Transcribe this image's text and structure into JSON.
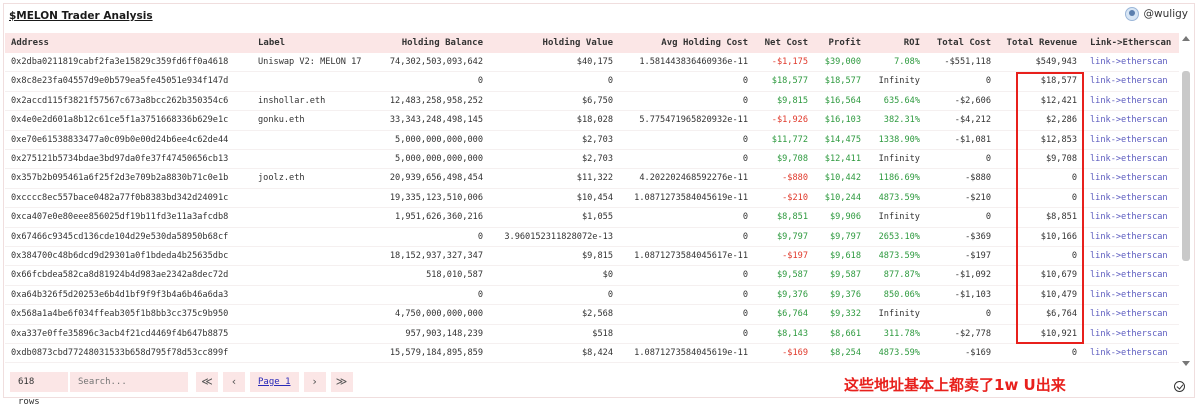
{
  "title": "$MELON Trader Analysis",
  "user": {
    "name": "@wuligy"
  },
  "table": {
    "headers": [
      "Address",
      "Label",
      "Holding Balance",
      "Holding Value",
      "Avg Holding Cost",
      "Net Cost",
      "Profit",
      "ROI",
      "Total Cost",
      "Total Revenue",
      "Link->Etherscan"
    ],
    "rows": [
      [
        "0x2dba0211819cabf2fa3e15829c359fd6ff0a4618",
        "Uniswap V2: MELON 17",
        "74,302,503,093,642",
        "$40,175",
        "1.581443836460936e-11",
        "-$1,175",
        "$39,000",
        "7.08%",
        "-$551,118",
        "$549,943",
        "link->etherscan"
      ],
      [
        "0x8c8e23fa04557d9e0b579ea5fe45051e934f147d",
        "",
        "0",
        "0",
        "0",
        "$18,577",
        "$18,577",
        "Infinity",
        "0",
        "$18,577",
        "link->etherscan"
      ],
      [
        "0x2accd115f3821f57567c673a8bcc262b350354c6",
        "inshollar.eth",
        "12,483,258,958,252",
        "$6,750",
        "0",
        "$9,815",
        "$16,564",
        "635.64%",
        "-$2,606",
        "$12,421",
        "link->etherscan"
      ],
      [
        "0x4e0e2d601a8b12c61ce5f1a3751668336b629e1c",
        "gonku.eth",
        "33,343,248,498,145",
        "$18,028",
        "5.775471965820932e-11",
        "-$1,926",
        "$16,103",
        "382.31%",
        "-$4,212",
        "$2,286",
        "link->etherscan"
      ],
      [
        "0xe70e61538833477a0c09b0e00d24b6ee4c62de44",
        "",
        "5,000,000,000,000",
        "$2,703",
        "0",
        "$11,772",
        "$14,475",
        "1338.90%",
        "-$1,081",
        "$12,853",
        "link->etherscan"
      ],
      [
        "0x275121b5734bdae3bd97da0fe37f47450656cb13",
        "",
        "5,000,000,000,000",
        "$2,703",
        "0",
        "$9,708",
        "$12,411",
        "Infinity",
        "0",
        "$9,708",
        "link->etherscan"
      ],
      [
        "0x357b2b095461a6f25f2d3e709b2a8830b71c0e1b",
        "joolz.eth",
        "20,939,656,498,454",
        "$11,322",
        "4.202202468592276e-11",
        "-$880",
        "$10,442",
        "1186.69%",
        "-$880",
        "0",
        "link->etherscan"
      ],
      [
        "0xcccc8ec557bace0482a77f0b8383bd342d24091c",
        "",
        "19,335,123,510,006",
        "$10,454",
        "1.0871273584045619e-11",
        "-$210",
        "$10,244",
        "4873.59%",
        "-$210",
        "0",
        "link->etherscan"
      ],
      [
        "0xca407e0e80eee856025df19b11fd3e11a3afcdb8",
        "",
        "1,951,626,360,216",
        "$1,055",
        "0",
        "$8,851",
        "$9,906",
        "Infinity",
        "0",
        "$8,851",
        "link->etherscan"
      ],
      [
        "0x67466c9345cd136cde104d29e530da58950b68cf",
        "",
        "0",
        "3.960152311828072e-13",
        "0",
        "$9,797",
        "$9,797",
        "2653.10%",
        "-$369",
        "$10,166",
        "link->etherscan"
      ],
      [
        "0x384700c48b6dcd9d29301a0f1bdeda4b25635dbc",
        "",
        "18,152,937,327,347",
        "$9,815",
        "1.0871273584045617e-11",
        "-$197",
        "$9,618",
        "4873.59%",
        "-$197",
        "0",
        "link->etherscan"
      ],
      [
        "0x66fcbdea582ca8d81924b4d983ae2342a8dec72d",
        "",
        "518,010,587",
        "$0",
        "0",
        "$9,587",
        "$9,587",
        "877.87%",
        "-$1,092",
        "$10,679",
        "link->etherscan"
      ],
      [
        "0xa64b326f5d20253e6b4d1bf9f9f3b4a6b46a6da3",
        "",
        "0",
        "0",
        "0",
        "$9,376",
        "$9,376",
        "850.06%",
        "-$1,103",
        "$10,479",
        "link->etherscan"
      ],
      [
        "0x568a1a4be6f034ffeab305f1b8bb3cc375c9b950",
        "",
        "4,750,000,000,000",
        "$2,568",
        "0",
        "$6,764",
        "$9,332",
        "Infinity",
        "0",
        "$6,764",
        "link->etherscan"
      ],
      [
        "0xa337e0ffe35896c3acb4f21cd4469f4b647b8875",
        "",
        "957,903,148,239",
        "$518",
        "0",
        "$8,143",
        "$8,661",
        "311.78%",
        "-$2,778",
        "$10,921",
        "link->etherscan"
      ],
      [
        "0xdb0873cbd77248031533b658d795f78d53cc899f",
        "",
        "15,579,184,895,859",
        "$8,424",
        "1.0871273584045619e-11",
        "-$169",
        "$8,254",
        "4873.59%",
        "-$169",
        "0",
        "link->etherscan"
      ]
    ]
  },
  "footer": {
    "rows_label": "618 rows",
    "search_placeholder": "Search...",
    "page_label": "Page 1"
  },
  "annotation": "这些地址基本上都卖了1w U出来",
  "colors": {
    "negative": "#e0392b",
    "positive": "#2e9a3f",
    "header_bg": "#fbe6e6",
    "highlight": "#e8201c",
    "link": "#5b5bbf"
  }
}
